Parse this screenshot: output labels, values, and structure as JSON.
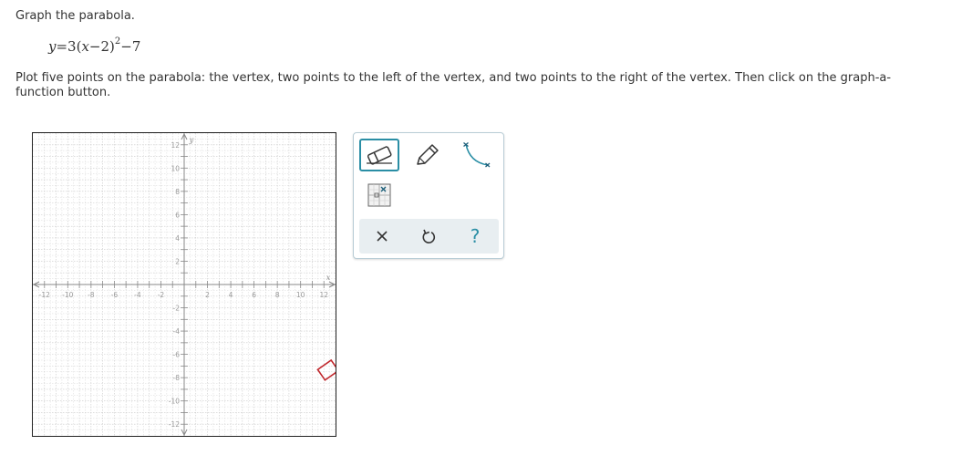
{
  "title": "Graph the parabola.",
  "equation": {
    "y": "y",
    "eq_text": "=3(",
    "x": "x",
    "minus_two": "−2)",
    "exponent": "2",
    "tail": "−7"
  },
  "instructions": "Plot five points on the parabola: the vertex, two points to the left of the vertex, and two points to the right of the vertex. Then click on the graph-a-function button.",
  "graph": {
    "x_axis_label": "x",
    "y_axis_label": "y",
    "x_min": -13,
    "x_max": 13,
    "y_min": -13,
    "y_max": 13,
    "x_tick_labels": [
      "-12",
      "-10",
      "-8",
      "-6",
      "-4",
      "-2",
      "2",
      "4",
      "6",
      "8",
      "10",
      "12"
    ],
    "y_tick_labels": [
      "12",
      "10",
      "8",
      "6",
      "4",
      "2",
      "-2",
      "-4",
      "-6",
      "-8",
      "-10",
      "-12"
    ],
    "grid_color": "#c9c9c9",
    "axis_color": "#8a8a8a"
  },
  "tools": {
    "eraser": "eraser-icon",
    "pencil": "pencil-icon",
    "curve": "curve-icon",
    "grapher": "graph-a-function-icon",
    "accent_color": "#2a8ea5"
  },
  "actions": {
    "clear": "close-icon",
    "undo": "undo-icon",
    "help": "?"
  }
}
